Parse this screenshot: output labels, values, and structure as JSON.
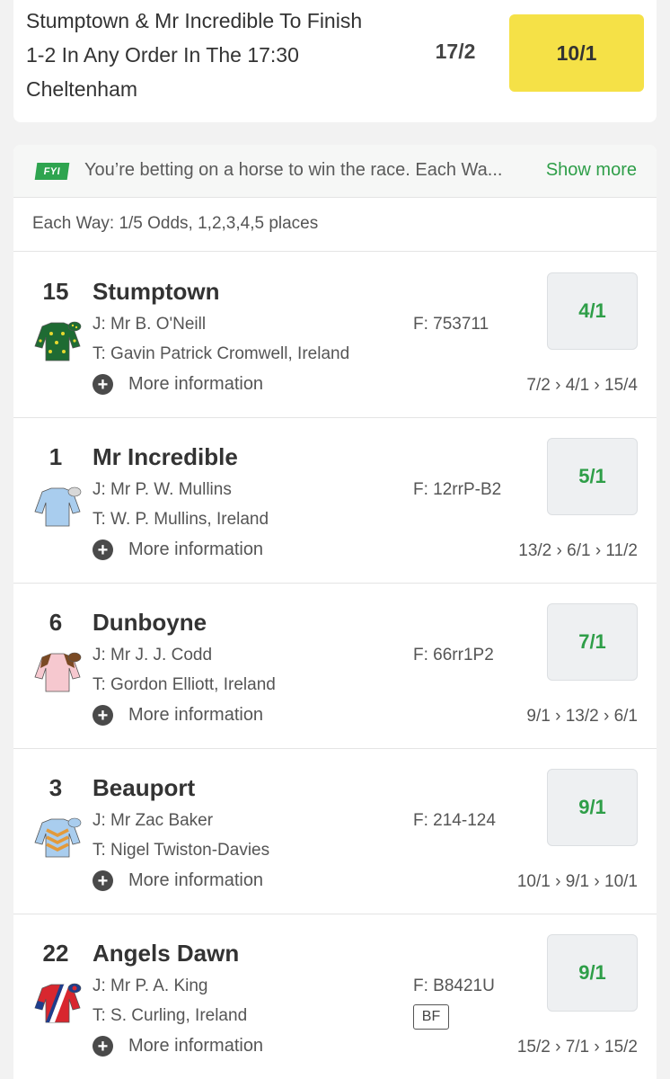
{
  "promo": {
    "title": "Stumptown & Mr Incredible To Finish 1-2 In Any Order In The 17:30 Cheltenham",
    "was_odds": "17/2",
    "boosted_odds": "10/1",
    "button_color": "#f5e147"
  },
  "fyi": {
    "badge": "FYI",
    "text": "You’re betting on a horse to win the race. Each Wa...",
    "show_more": "Show more",
    "badge_color": "#2ea44f"
  },
  "each_way": "Each Way: 1/5 Odds, 1,2,3,4,5 places",
  "runners": [
    {
      "number": "15",
      "name": "Stumptown",
      "jockey": "J: Mr B. O'Neill",
      "trainer": "T: Gavin Patrick Cromwell, Ireland",
      "form": "F: 753711",
      "odds": "4/1",
      "history": "7/2 › 4/1 › 15/4",
      "more_info": "More information",
      "silk_icon": "silk-green-yellow-stars-icon"
    },
    {
      "number": "1",
      "name": "Mr Incredible",
      "jockey": "J: Mr P. W. Mullins",
      "trainer": "T: W. P. Mullins, Ireland",
      "form": "F: 12rrP-B2",
      "odds": "5/1",
      "history": "13/2 › 6/1 › 11/2",
      "more_info": "More information",
      "silk_icon": "silk-light-blue-icon"
    },
    {
      "number": "6",
      "name": "Dunboyne",
      "jockey": "J: Mr J. J. Codd",
      "trainer": "T: Gordon Elliott, Ireland",
      "form": "F: 66rr1P2",
      "odds": "7/1",
      "history": "9/1 › 13/2 › 6/1",
      "more_info": "More information",
      "silk_icon": "silk-pink-brown-icon"
    },
    {
      "number": "3",
      "name": "Beauport",
      "jockey": "J: Mr Zac Baker",
      "trainer": "T: Nigel Twiston-Davies",
      "form": "F: 214-124",
      "odds": "9/1",
      "history": "10/1 › 9/1 › 10/1",
      "more_info": "More information",
      "silk_icon": "silk-blue-orange-chevrons-icon"
    },
    {
      "number": "22",
      "name": "Angels Dawn",
      "jockey": "J: Mr P. A. King",
      "trainer": "T: S. Curling, Ireland",
      "form": "F: B8421U",
      "badge": "BF",
      "odds": "9/1",
      "history": "15/2 › 7/1 › 15/2",
      "more_info": "More information",
      "silk_icon": "silk-red-blue-white-icon"
    }
  ],
  "colors": {
    "odds_green": "#2e9e48",
    "odds_button_bg": "#eef0f2"
  }
}
